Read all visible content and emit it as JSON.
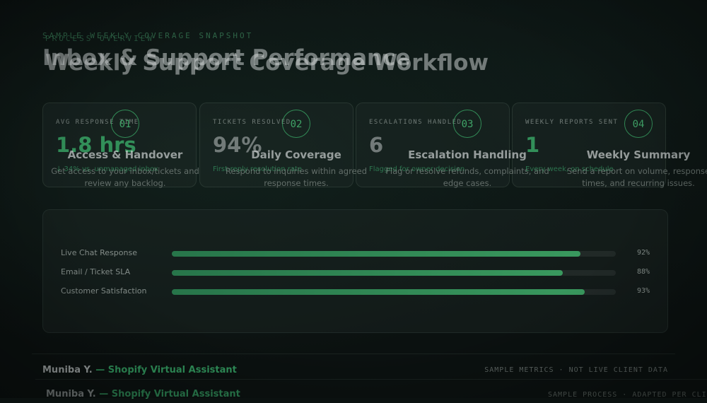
{
  "snapshot": {
    "eyebrow": "SAMPLE WEEKLY COVERAGE SNAPSHOT",
    "title": "Inbox & Support Performance",
    "stats": [
      {
        "label": "AVG RESPONSE TIME",
        "value": "1.8 hrs",
        "sub": "↓ 34% vs. unmanaged inbox"
      },
      {
        "label": "TICKETS RESOLVED",
        "value": "94%",
        "sub": "First-reply resolution rate"
      },
      {
        "label": "ESCALATIONS HANDLED",
        "value": "6",
        "sub": "Flagged for owner decision"
      },
      {
        "label": "WEEKLY REPORTS SENT",
        "value": "1",
        "sub": "Every week, on schedule"
      }
    ],
    "metrics": [
      {
        "label": "Live Chat Response",
        "value": "92%",
        "percent": 92
      },
      {
        "label": "Email / Ticket SLA",
        "value": "88%",
        "percent": 88
      },
      {
        "label": "Customer Satisfaction",
        "value": "93%",
        "percent": 93
      }
    ],
    "footer": {
      "name": "Muniba Y.",
      "role": "— Shopify Virtual Assistant",
      "note": "SAMPLE METRICS  ·  NOT LIVE CLIENT DATA"
    }
  },
  "process": {
    "eyebrow": "PROCESS OVERVIEW",
    "title": "Weekly Support Coverage Workflow",
    "steps": [
      {
        "num": "01",
        "title": "Access & Handover",
        "desc": "Get access to your inbox/tickets and review any backlog."
      },
      {
        "num": "02",
        "title": "Daily Coverage",
        "desc": "Respond to inquiries within agreed response times."
      },
      {
        "num": "03",
        "title": "Escalation Handling",
        "desc": "Flag or resolve refunds, complaints, and edge cases."
      },
      {
        "num": "04",
        "title": "Weekly Summary",
        "desc": "Send a report on volume, response times, and recurring issues."
      }
    ],
    "footer": {
      "name": "Muniba Y.",
      "role": "— Shopify Virtual Assistant",
      "note": "SAMPLE PROCESS  ·  ADAPTED PER CLIENT"
    }
  }
}
